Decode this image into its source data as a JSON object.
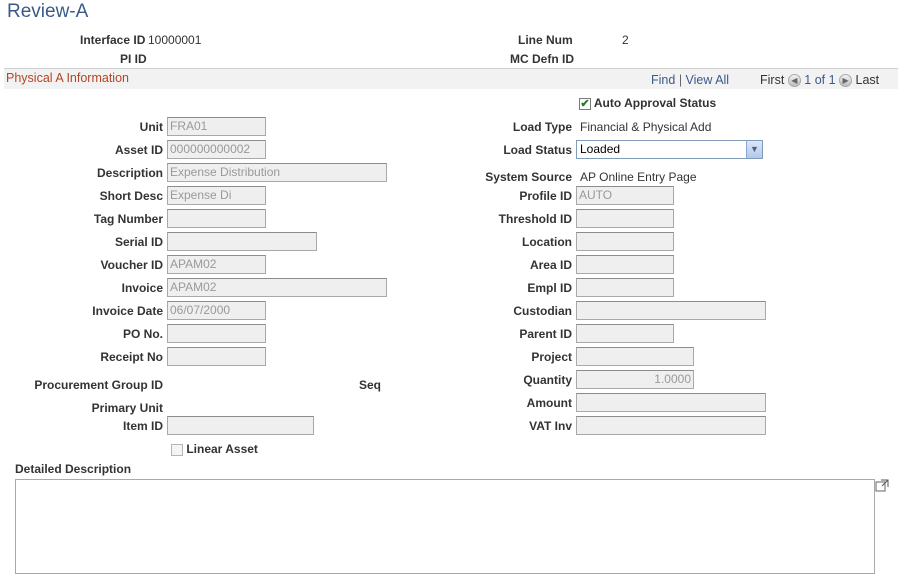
{
  "page": {
    "title": "Review-A"
  },
  "header": {
    "interface_id_label": "Interface ID",
    "interface_id_value": "10000001",
    "pi_id_label": "PI ID",
    "line_num_label": "Line Num",
    "line_num_value": "2",
    "mc_defn_id_label": "MC Defn ID"
  },
  "section": {
    "title": "Physical A Information",
    "find": "Find",
    "sep": "|",
    "view_all": "View All",
    "first": "First",
    "range": "1 of 1",
    "last": "Last"
  },
  "left": {
    "unit": {
      "label": "Unit",
      "value": "FRA01"
    },
    "asset_id": {
      "label": "Asset ID",
      "value": "000000000002"
    },
    "description": {
      "label": "Description",
      "value": "Expense Distribution"
    },
    "short_desc": {
      "label": "Short Desc",
      "value": "Expense Di"
    },
    "tag_number": {
      "label": "Tag Number",
      "value": ""
    },
    "serial_id": {
      "label": "Serial ID",
      "value": ""
    },
    "voucher_id": {
      "label": "Voucher ID",
      "value": "APAM02"
    },
    "invoice": {
      "label": "Invoice",
      "value": "APAM02"
    },
    "invoice_date": {
      "label": "Invoice Date",
      "value": "06/07/2000"
    },
    "po_no": {
      "label": "PO No.",
      "value": ""
    },
    "receipt_no": {
      "label": "Receipt No",
      "value": ""
    },
    "procurement_group_id": {
      "label": "Procurement Group ID"
    },
    "seq": {
      "label": "Seq"
    },
    "primary_unit": {
      "label": "Primary Unit"
    },
    "item_id": {
      "label": "Item ID",
      "value": ""
    },
    "linear_asset": {
      "label": "Linear Asset",
      "checked": false
    }
  },
  "right": {
    "auto_approval": {
      "label": "Auto Approval Status",
      "checked": true
    },
    "load_type": {
      "label": "Load Type",
      "value": "Financial & Physical Add"
    },
    "load_status": {
      "label": "Load Status",
      "value": "Loaded"
    },
    "system_source": {
      "label": "System Source",
      "value": "AP Online Entry Page"
    },
    "profile_id": {
      "label": "Profile ID",
      "value": "AUTO"
    },
    "threshold_id": {
      "label": "Threshold ID",
      "value": ""
    },
    "location": {
      "label": "Location",
      "value": ""
    },
    "area_id": {
      "label": "Area ID",
      "value": ""
    },
    "empl_id": {
      "label": "Empl ID",
      "value": ""
    },
    "custodian": {
      "label": "Custodian",
      "value": ""
    },
    "parent_id": {
      "label": "Parent ID",
      "value": ""
    },
    "project": {
      "label": "Project",
      "value": ""
    },
    "quantity": {
      "label": "Quantity",
      "value": "1.0000"
    },
    "amount": {
      "label": "Amount",
      "value": ""
    },
    "vat_inv": {
      "label": "VAT Inv",
      "value": ""
    }
  },
  "detailed_description": {
    "label": "Detailed Description",
    "value": ""
  },
  "colors": {
    "title": "#3a5a8c",
    "section_title": "#b24526",
    "link": "#3a5a8c"
  }
}
